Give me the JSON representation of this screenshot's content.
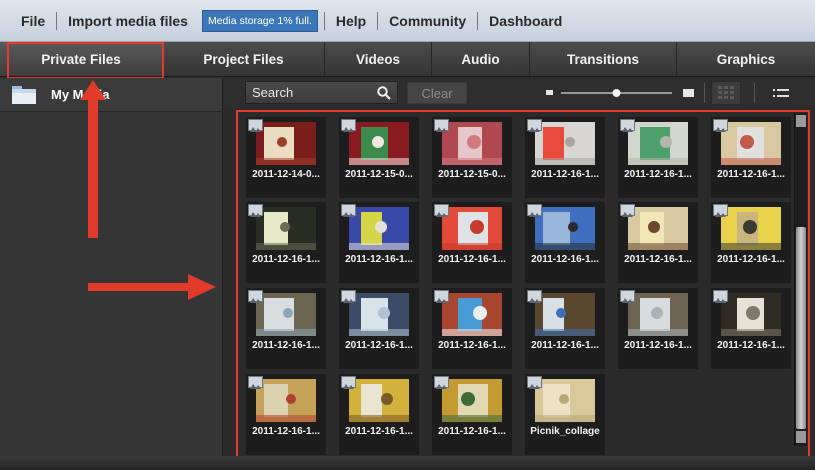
{
  "menubar": {
    "file": "File",
    "import": "Import media files",
    "storage": "Media storage 1% full.",
    "help": "Help",
    "community": "Community",
    "dashboard": "Dashboard"
  },
  "tabs": [
    {
      "label": "Private Files"
    },
    {
      "label": "Project Files"
    },
    {
      "label": "Videos"
    },
    {
      "label": "Audio"
    },
    {
      "label": "Transitions"
    },
    {
      "label": "Graphics"
    }
  ],
  "sidebar": {
    "items": [
      {
        "label": "My Media",
        "icon": "folder-icon"
      }
    ]
  },
  "toolbar": {
    "search_placeholder": "Search",
    "clear": "Clear",
    "zoom_level": 0.5
  },
  "media": [
    {
      "caption": "2011-12-14-0...",
      "palette": [
        "#7a1d1d",
        "#e9dcc2",
        "#a03c2a"
      ]
    },
    {
      "caption": "2011-12-15-0...",
      "palette": [
        "#8a1a22",
        "#3d8b4c",
        "#f0e8e0"
      ]
    },
    {
      "caption": "2011-12-15-0...",
      "palette": [
        "#b04850",
        "#e6c7c9",
        "#d07a80"
      ]
    },
    {
      "caption": "2011-12-16-1...",
      "palette": [
        "#d7d6d3",
        "#e84a3b",
        "#a6a5a2"
      ]
    },
    {
      "caption": "2011-12-16-1...",
      "palette": [
        "#d3d6cc",
        "#4ea06a",
        "#b4b6ab"
      ]
    },
    {
      "caption": "2011-12-16-1...",
      "palette": [
        "#d9c7a2",
        "#e1e0dc",
        "#c05a4a"
      ]
    },
    {
      "caption": "2011-12-16-1...",
      "palette": [
        "#2a2d22",
        "#e5e9c8",
        "#6a6a55"
      ]
    },
    {
      "caption": "2011-12-16-1...",
      "palette": [
        "#3a48a8",
        "#d6d447",
        "#e4e1d8"
      ]
    },
    {
      "caption": "2011-12-16-1...",
      "palette": [
        "#e24a3a",
        "#e0e3e6",
        "#c63a2c"
      ]
    },
    {
      "caption": "2011-12-16-1...",
      "palette": [
        "#3f6fbe",
        "#9ab6d8",
        "#2a2c30"
      ]
    },
    {
      "caption": "2011-12-16-1...",
      "palette": [
        "#d9c9a2",
        "#f2e6b6",
        "#6a4a2a"
      ]
    },
    {
      "caption": "2011-12-16-1...",
      "palette": [
        "#e8d14a",
        "#c8b47c",
        "#3a3a30"
      ]
    },
    {
      "caption": "2011-12-16-1...",
      "palette": [
        "#6a6450",
        "#d9dde0",
        "#8ca5b8"
      ]
    },
    {
      "caption": "2011-12-16-1...",
      "palette": [
        "#3b4c66",
        "#d7e4ea",
        "#b0c2cc"
      ]
    },
    {
      "caption": "2011-12-16-1...",
      "palette": [
        "#a8452f",
        "#4a9ad3",
        "#e9eef1"
      ]
    },
    {
      "caption": "2011-12-16-1...",
      "palette": [
        "#5a4730",
        "#d8e0e6",
        "#3a70b8"
      ]
    },
    {
      "caption": "2011-12-16-1...",
      "palette": [
        "#6c6450",
        "#d8dcde",
        "#a8b2b8"
      ]
    },
    {
      "caption": "2011-12-16-1...",
      "palette": [
        "#2f2c24",
        "#e6e1d6",
        "#7e7868"
      ]
    },
    {
      "caption": "2011-12-16-1...",
      "palette": [
        "#c5a25a",
        "#ddd3b3",
        "#b0402c"
      ]
    },
    {
      "caption": "2011-12-16-1...",
      "palette": [
        "#d2b23a",
        "#e9e3cf",
        "#7a5a2a"
      ]
    },
    {
      "caption": "2011-12-16-1...",
      "palette": [
        "#c49a32",
        "#e2d8b2",
        "#3c6a3a"
      ]
    },
    {
      "caption": "Picnik_collage",
      "palette": [
        "#d8c89a",
        "#ece2c4",
        "#b8a878"
      ]
    }
  ],
  "colors": {
    "highlight": "#e23b2a",
    "menubar": "#d3dbe4",
    "storage_badge": "#3b77b8"
  }
}
